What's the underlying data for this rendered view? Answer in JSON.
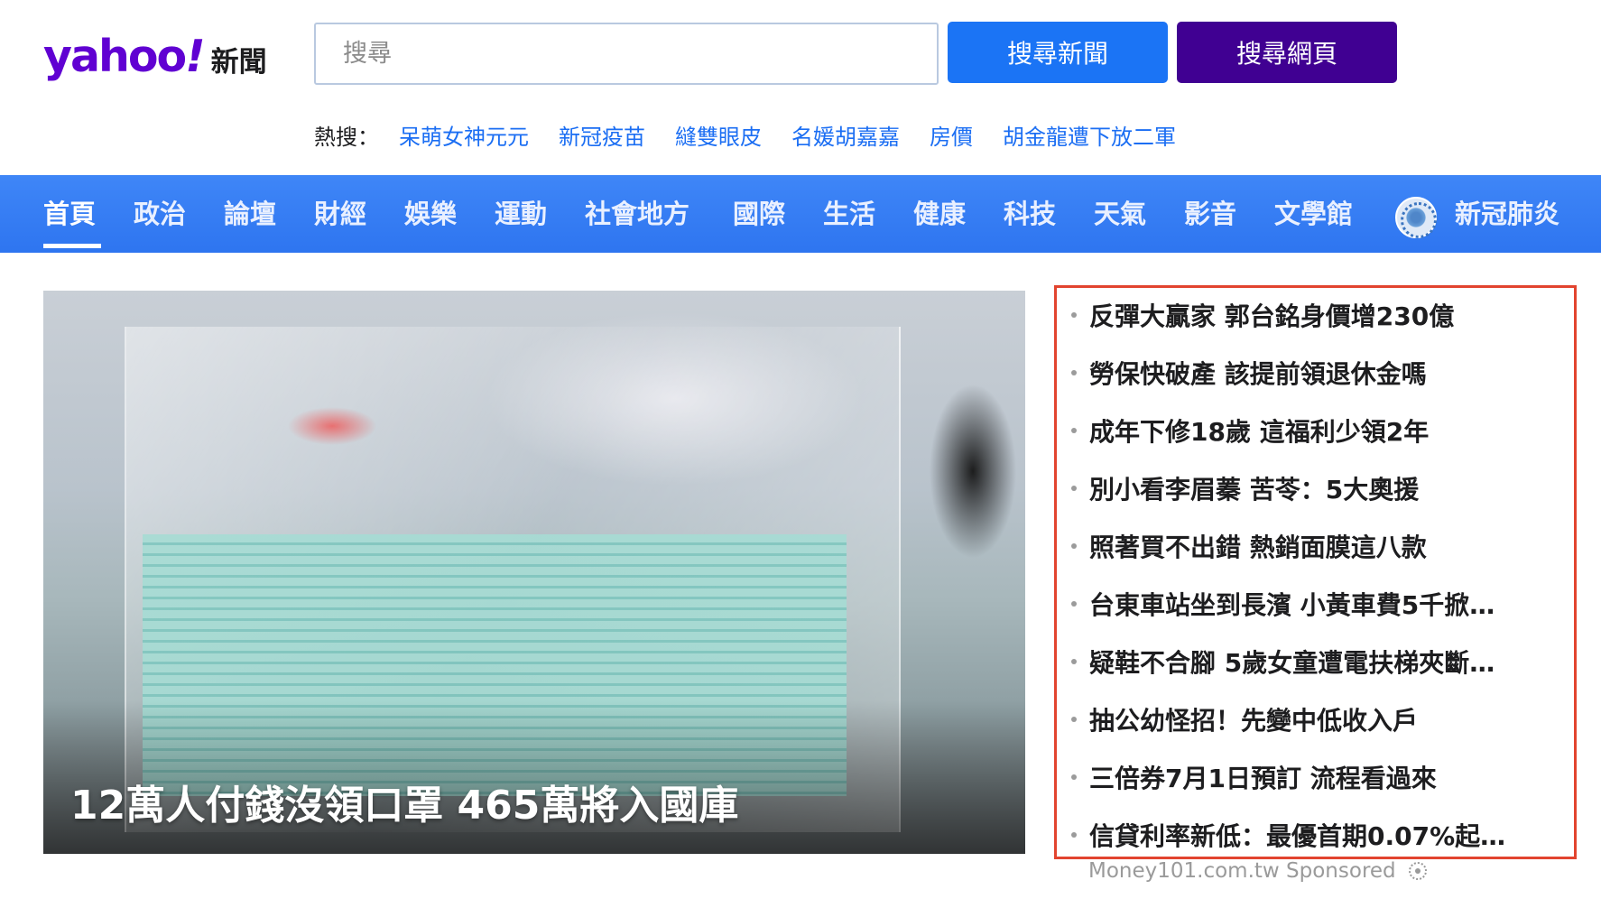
{
  "brand": {
    "logo": "yahoo",
    "logo_bang": "!",
    "section": "新聞",
    "color": "#6001d2"
  },
  "search": {
    "placeholder": "搜尋",
    "news_button": "搜尋新聞",
    "web_button": "搜尋網頁"
  },
  "trending": {
    "label": "熱搜：",
    "items": [
      "呆萌女神元元",
      "新冠疫苗",
      "縫雙眼皮",
      "名媛胡嘉嘉",
      "房價",
      "胡金龍遭下放二軍"
    ]
  },
  "nav": {
    "active": "首頁",
    "items": [
      "首頁",
      "政治",
      "論壇",
      "財經",
      "娛樂",
      "運動",
      "社會地方",
      "國際",
      "生活",
      "健康",
      "科技",
      "天氣",
      "影音",
      "文學館",
      "新冠肺炎"
    ],
    "special_icon": "coronavirus-icon"
  },
  "hero": {
    "caption": "12萬人付錢沒領口罩 465萬將入國庫"
  },
  "headlines": [
    "反彈大贏家 郭台銘身價增230億",
    "勞保快破產 該提前領退休金嗎",
    "成年下修18歲 這福利少領2年",
    "別小看李眉蓁 苦苓：5大奧援",
    "照著買不出錯 熱銷面膜這八款",
    "台東車站坐到長濱 小黃車費5千掀…",
    "疑鞋不合腳 5歲女童遭電扶梯夾斷…",
    "抽公幼怪招！先變中低收入戶",
    "三倍券7月1日預訂 流程看過來",
    "信貸利率新低：最優首期0.07%起…"
  ],
  "sponsor": {
    "text": "Money101.com.tw Sponsored",
    "icon": "adchoices-icon"
  },
  "colors": {
    "nav_bg": "#2e75f0",
    "news_button": "#1b74f5",
    "web_button": "#400092",
    "trending_link": "#1b6ef3",
    "highlight_border": "#e2442f"
  }
}
